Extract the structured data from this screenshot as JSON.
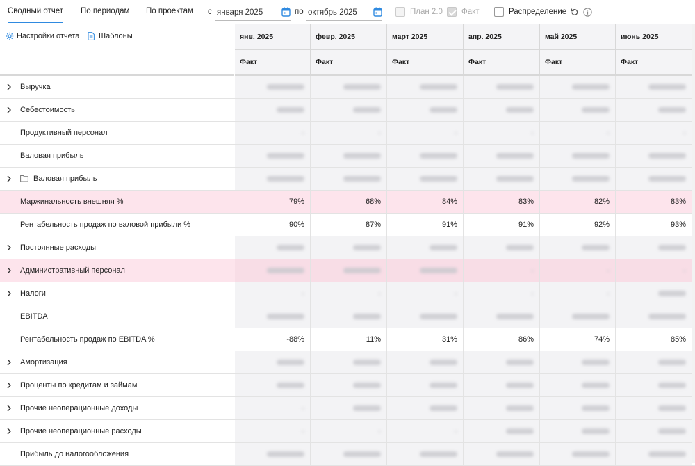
{
  "tabs": [
    {
      "label": "Сводный отчет",
      "active": true
    },
    {
      "label": "По периодам",
      "active": false
    },
    {
      "label": "По проектам",
      "active": false
    }
  ],
  "period": {
    "from_label": "с",
    "from_value": "января 2025",
    "to_label": "по",
    "to_value": "октябрь 2025"
  },
  "toggles": {
    "plan_label": "План 2.0",
    "fact_label": "Факт",
    "distribution_label": "Распределение"
  },
  "panel": {
    "settings_label": "Настройки отчета",
    "templates_label": "Шаблоны"
  },
  "columns": [
    {
      "month": "янв. 2025",
      "kind": "Факт"
    },
    {
      "month": "февр. 2025",
      "kind": "Факт"
    },
    {
      "month": "март 2025",
      "kind": "Факт"
    },
    {
      "month": "апр. 2025",
      "kind": "Факт"
    },
    {
      "month": "май 2025",
      "kind": "Факт"
    },
    {
      "month": "июнь 2025",
      "kind": "Факт"
    }
  ],
  "rows": [
    {
      "label": "Выручка",
      "expandable": true,
      "bold": true,
      "folder": false,
      "pink": false,
      "values": null
    },
    {
      "label": "Себестоимость",
      "expandable": true,
      "bold": true,
      "folder": false,
      "pink": false,
      "values": null
    },
    {
      "label": "Продуктивный персонал",
      "expandable": false,
      "bold": true,
      "folder": false,
      "pink": false,
      "values": null
    },
    {
      "label": "Валовая прибыль",
      "expandable": false,
      "bold": false,
      "folder": false,
      "pink": false,
      "values": null
    },
    {
      "label": "Валовая прибыль",
      "expandable": true,
      "bold": false,
      "folder": true,
      "pink": false,
      "values": null
    },
    {
      "label": "Маржинальность внешняя %",
      "expandable": false,
      "bold": false,
      "folder": false,
      "pink": true,
      "values": [
        "79%",
        "68%",
        "84%",
        "83%",
        "82%",
        "83%"
      ]
    },
    {
      "label": "Рентабельность продаж по валовой прибыли %",
      "expandable": false,
      "bold": false,
      "folder": false,
      "pink": false,
      "values": [
        "90%",
        "87%",
        "91%",
        "91%",
        "92%",
        "93%"
      ]
    },
    {
      "label": "Постоянные расходы",
      "expandable": true,
      "bold": true,
      "folder": false,
      "pink": false,
      "values": null
    },
    {
      "label": "Административный персонал",
      "expandable": true,
      "bold": true,
      "folder": false,
      "pink": true,
      "values": null
    },
    {
      "label": "Налоги",
      "expandable": true,
      "bold": true,
      "folder": false,
      "pink": false,
      "values": null
    },
    {
      "label": "EBITDA",
      "expandable": false,
      "bold": false,
      "folder": false,
      "pink": false,
      "values": null
    },
    {
      "label": "Рентабельность продаж по EBITDA %",
      "expandable": false,
      "bold": false,
      "folder": false,
      "pink": false,
      "values": [
        "-88%",
        "11%",
        "31%",
        "86%",
        "74%",
        "85%"
      ]
    },
    {
      "label": "Амортизация",
      "expandable": true,
      "bold": true,
      "folder": false,
      "pink": false,
      "values": null
    },
    {
      "label": "Проценты по кредитам и займам",
      "expandable": true,
      "bold": true,
      "folder": false,
      "pink": false,
      "values": null
    },
    {
      "label": "Прочие неоперационные доходы",
      "expandable": true,
      "bold": false,
      "folder": false,
      "pink": false,
      "values": null
    },
    {
      "label": "Прочие неоперационные расходы",
      "expandable": true,
      "bold": false,
      "folder": false,
      "pink": false,
      "values": null
    },
    {
      "label": "Прибыль до налогообложения",
      "expandable": false,
      "bold": false,
      "folder": false,
      "pink": false,
      "values": null
    }
  ],
  "colors": {
    "accent": "#2f8ae0",
    "pink_row": "#fde4ec",
    "header_bg": "#f4f4f6"
  },
  "icons": {
    "settings": "gear-icon",
    "templates": "document-icon",
    "calendar": "calendar-icon",
    "reset": "reset-icon",
    "info": "info-icon",
    "expand": "chevron-right-icon",
    "folder": "folder-icon"
  }
}
